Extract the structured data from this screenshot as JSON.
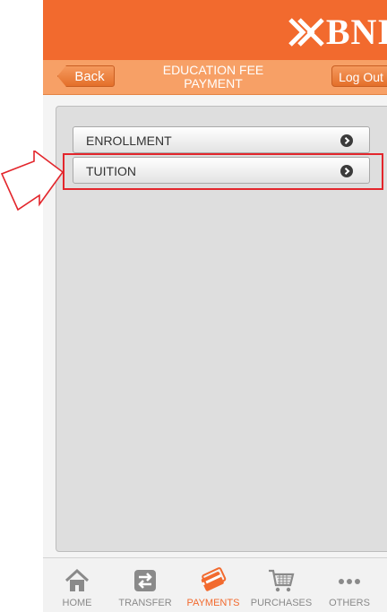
{
  "brand": {
    "name": "BNI"
  },
  "navbar": {
    "back_label": "Back",
    "title": "EDUCATION FEE PAYMENT",
    "logout_label": "Log Out"
  },
  "menu": {
    "items": [
      {
        "label": "ENROLLMENT"
      },
      {
        "label": "TUITION"
      }
    ]
  },
  "tabs": [
    {
      "label": "HOME",
      "icon": "home-icon",
      "active": false
    },
    {
      "label": "TRANSFER",
      "icon": "transfer-icon",
      "active": false
    },
    {
      "label": "PAYMENTS",
      "icon": "payments-icon",
      "active": true
    },
    {
      "label": "PURCHASES",
      "icon": "cart-icon",
      "active": false
    },
    {
      "label": "OTHERS",
      "icon": "more-icon",
      "active": false
    }
  ],
  "colors": {
    "brand_orange": "#f26a2e",
    "nav_orange": "#f7a066",
    "highlight_red": "#e3262c",
    "tab_inactive": "#8a8a8a"
  }
}
